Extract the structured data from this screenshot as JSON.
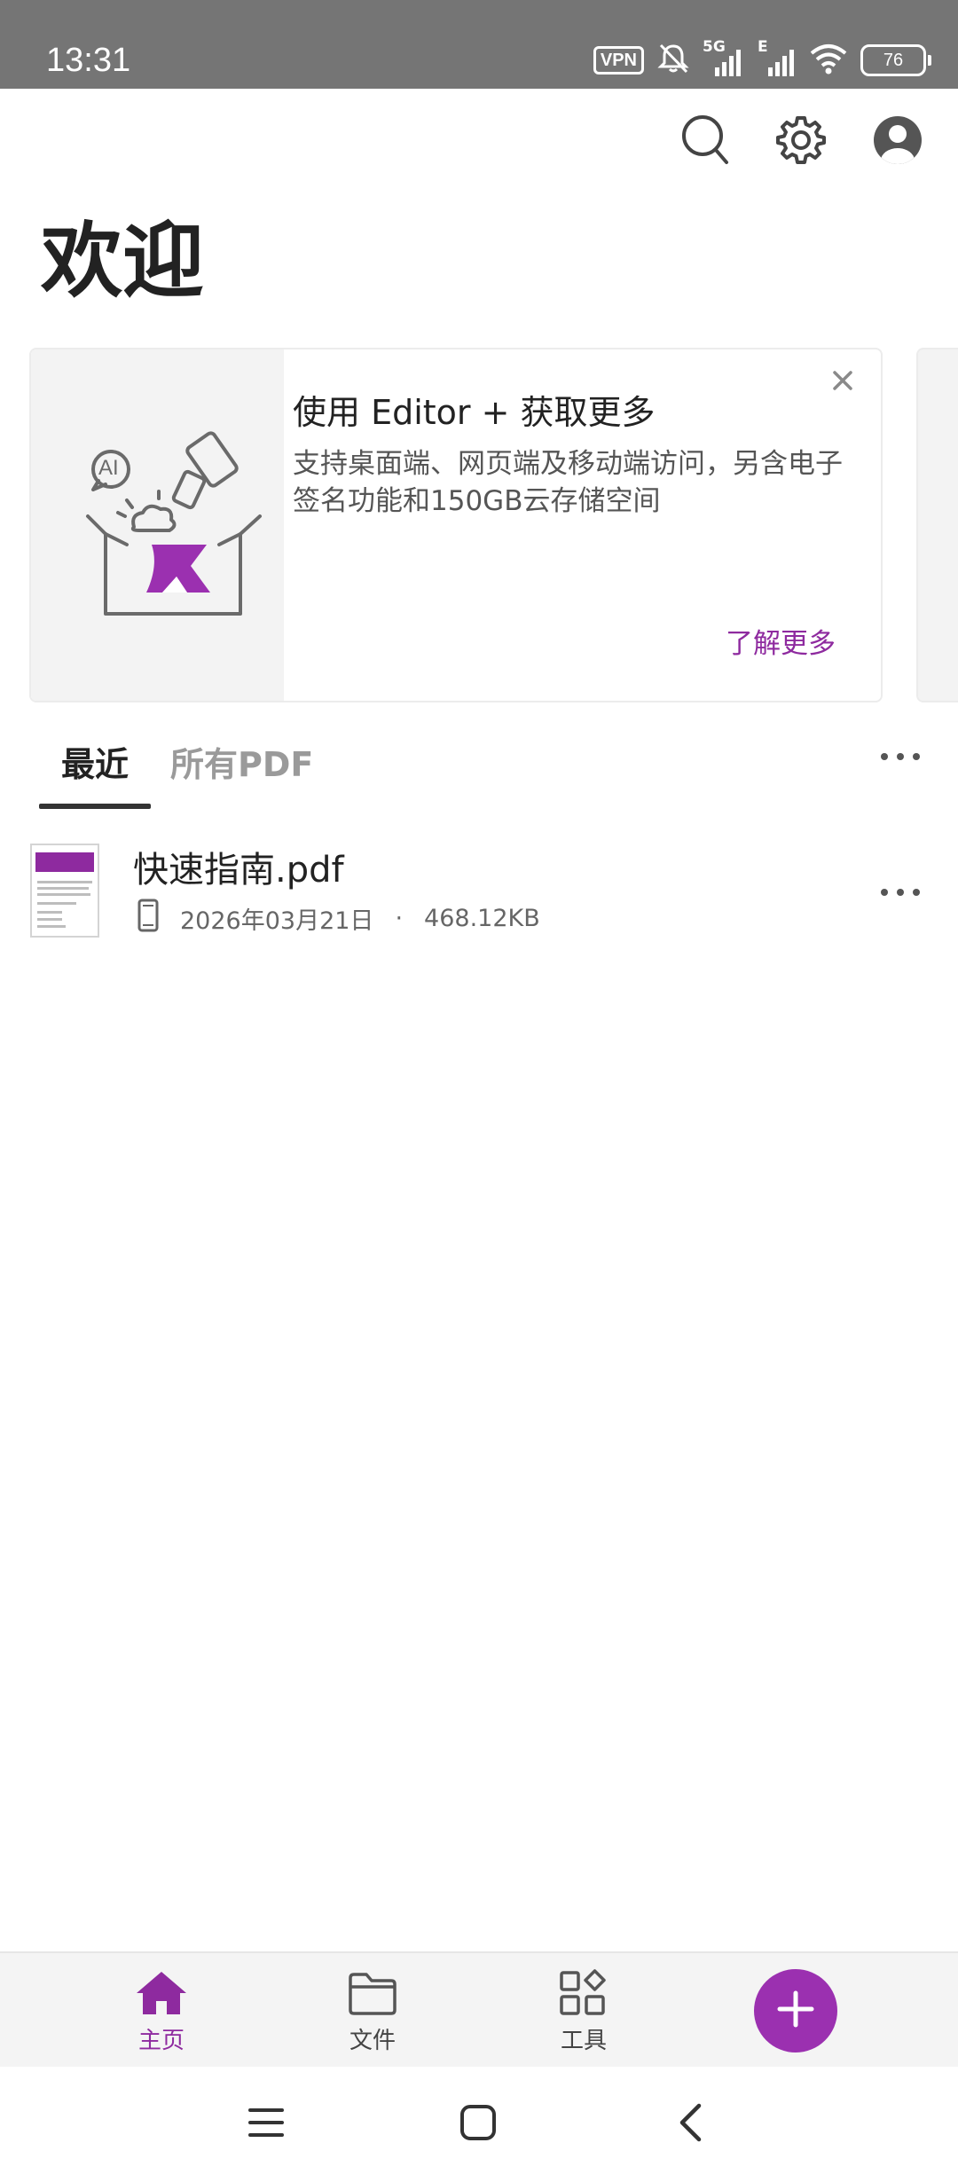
{
  "status_bar": {
    "time": "13:31",
    "vpn_label": "VPN",
    "network_label": "5G",
    "network_label_2": "E",
    "battery_level": "76",
    "icons": [
      "vpn-icon",
      "bell-off-icon",
      "signal-icon",
      "signal-icon",
      "wifi-icon",
      "battery-icon"
    ]
  },
  "header": {
    "title": "欢迎",
    "icons": [
      "search-icon",
      "gear-icon",
      "account-icon"
    ]
  },
  "promo": {
    "title": "使用 Editor + 获取更多",
    "description": "支持桌面端、网页端及移动端访问，另含电子签名功能和150GB云存储空间",
    "link_label": "了解更多",
    "illustration_text": "AI"
  },
  "tabs": {
    "items": [
      {
        "label": "最近",
        "active": true
      },
      {
        "label": "所有PDF",
        "active": false
      }
    ]
  },
  "files": [
    {
      "name": "快速指南.pdf",
      "date": "2026年03月21日",
      "separator": "·",
      "size": "468.12KB"
    }
  ],
  "bottom_nav": {
    "items": [
      {
        "label": "主页",
        "icon": "home-icon",
        "active": true
      },
      {
        "label": "文件",
        "icon": "folder-icon",
        "active": false
      },
      {
        "label": "工具",
        "icon": "tools-grid-icon",
        "active": false
      }
    ],
    "fab_icon": "plus-icon"
  },
  "colors": {
    "accent": "#8e2a9f",
    "fab": "#9b30b0",
    "status_bar": "#757575",
    "nav_background": "#f4f4f4"
  }
}
